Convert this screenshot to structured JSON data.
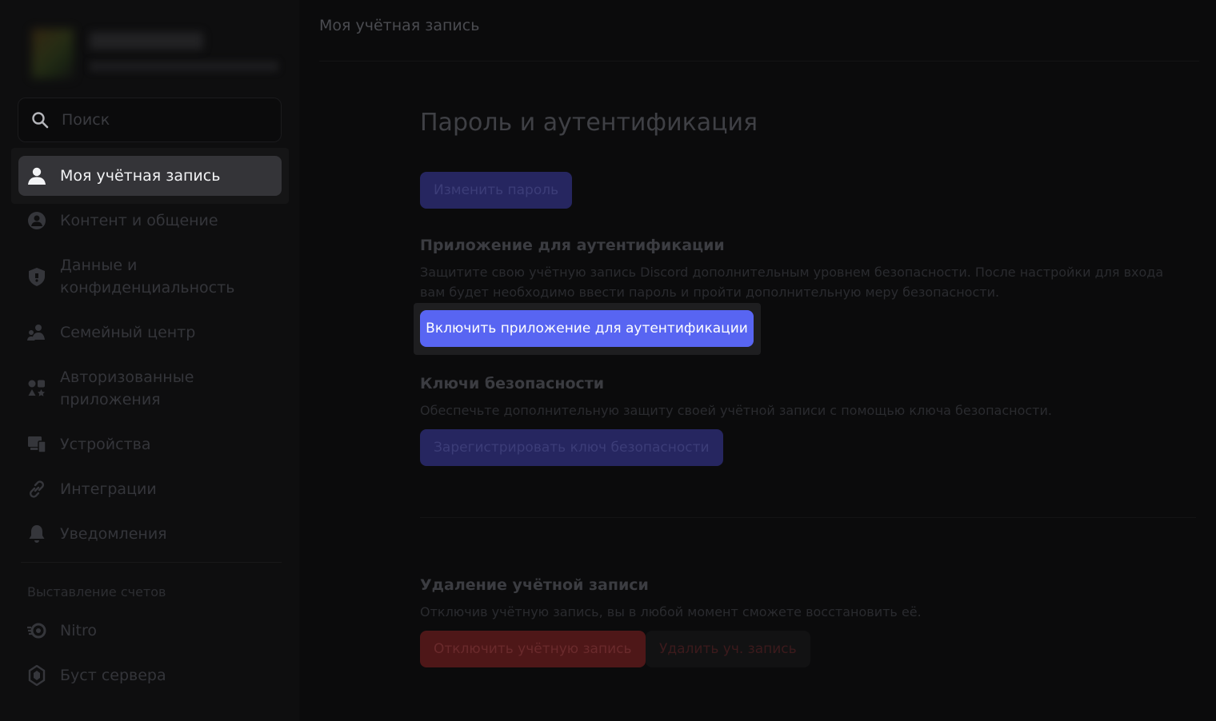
{
  "sidebar": {
    "search": {
      "placeholder": "Поиск"
    },
    "active_item": {
      "label": "Моя учётная запись",
      "icon": "person-icon"
    },
    "items": [
      {
        "label": "Контент и общение",
        "icon": "content-icon"
      },
      {
        "label": "Данные и конфиденциальность",
        "icon": "shield-icon"
      },
      {
        "label": "Семейный центр",
        "icon": "family-icon"
      },
      {
        "label": "Авторизованные приложения",
        "icon": "apps-icon"
      },
      {
        "label": "Устройства",
        "icon": "devices-icon"
      },
      {
        "label": "Интеграции",
        "icon": "link-icon"
      },
      {
        "label": "Уведомления",
        "icon": "bell-icon"
      }
    ],
    "billing_section": {
      "header": "Выставление счетов",
      "items": [
        {
          "label": "Nitro",
          "icon": "nitro-icon"
        },
        {
          "label": "Буст сервера",
          "icon": "boost-icon"
        }
      ]
    }
  },
  "main": {
    "topbar_title": "Моя учётная запись",
    "password_section": {
      "title": "Пароль и аутентификация",
      "change_password_button": "Изменить пароль"
    },
    "auth_app_section": {
      "title": "Приложение для аутентификации",
      "description": "Защитите свою учётную запись Discord дополнительным уровнем безопасности. После настройки для входа вам будет необходимо ввести пароль и пройти дополнительную меру безопасности.",
      "enable_button": "Включить приложение для аутентификации"
    },
    "security_keys_section": {
      "title": "Ключи безопасности",
      "description": "Обеспечьте дополнительную защиту своей учётной записи с помощью ключа безопасности.",
      "register_button": "Зарегистрировать ключ безопасности"
    },
    "delete_section": {
      "title": "Удаление учётной записи",
      "description": "Отключив учётную запись, вы в любой момент сможете восстановить её.",
      "disable_button": "Отключить учётную запись",
      "delete_button": "Удалить уч. запись"
    }
  },
  "colors": {
    "accent": "#5865f2",
    "danger": "#da373c"
  }
}
